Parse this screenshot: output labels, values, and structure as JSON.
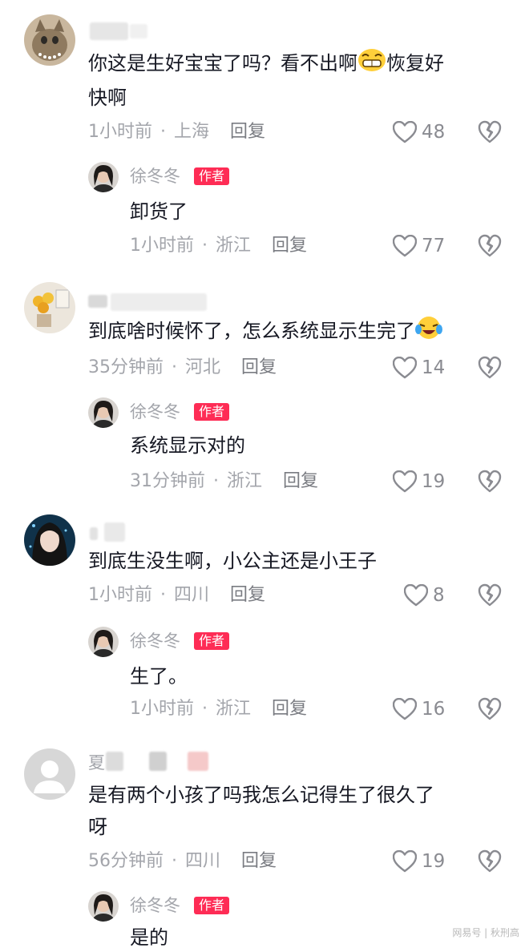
{
  "comments": [
    {
      "text_line1": "你这是生好宝宝了吗？看不出啊",
      "text_line1_tail": "恢复好",
      "text_line2": "快啊",
      "time": "1小时前",
      "location": "上海",
      "reply_label": "回复",
      "likes": "48",
      "emoji": "grinning-face-emoji",
      "reply": {
        "author": "徐冬冬",
        "badge": "作者",
        "text": "卸货了",
        "time": "1小时前",
        "location": "浙江",
        "reply_label": "回复",
        "likes": "77"
      }
    },
    {
      "text_line1": "到底啥时候怀了，怎么系统显示生完了",
      "time": "35分钟前",
      "location": "河北",
      "reply_label": "回复",
      "likes": "14",
      "emoji": "crying-laughing-emoji",
      "reply": {
        "author": "徐冬冬",
        "badge": "作者",
        "text": "系统显示对的",
        "time": "31分钟前",
        "location": "浙江",
        "reply_label": "回复",
        "likes": "19"
      }
    },
    {
      "text_line1": "到底生没生啊，小公主还是小王子",
      "time": "1小时前",
      "location": "四川",
      "reply_label": "回复",
      "likes": "8",
      "reply": {
        "author": "徐冬冬",
        "badge": "作者",
        "text": "生了。",
        "time": "1小时前",
        "location": "浙江",
        "reply_label": "回复",
        "likes": "16"
      }
    },
    {
      "username_fragment": "夏",
      "text_line1": "是有两个小孩了吗我怎么记得生了很久了",
      "text_line2": "呀",
      "time": "56分钟前",
      "location": "四川",
      "reply_label": "回复",
      "likes": "19",
      "reply": {
        "author": "徐冬冬",
        "badge": "作者",
        "text": "是的"
      }
    }
  ],
  "separator": "·",
  "watermark": "网易号 | 秋刑高",
  "colors": {
    "badge": "#fe2c55",
    "meta": "#a3a5ab",
    "text": "#161823"
  },
  "icons": [
    "heart-outline-icon",
    "broken-heart-icon",
    "default-avatar-icon"
  ]
}
